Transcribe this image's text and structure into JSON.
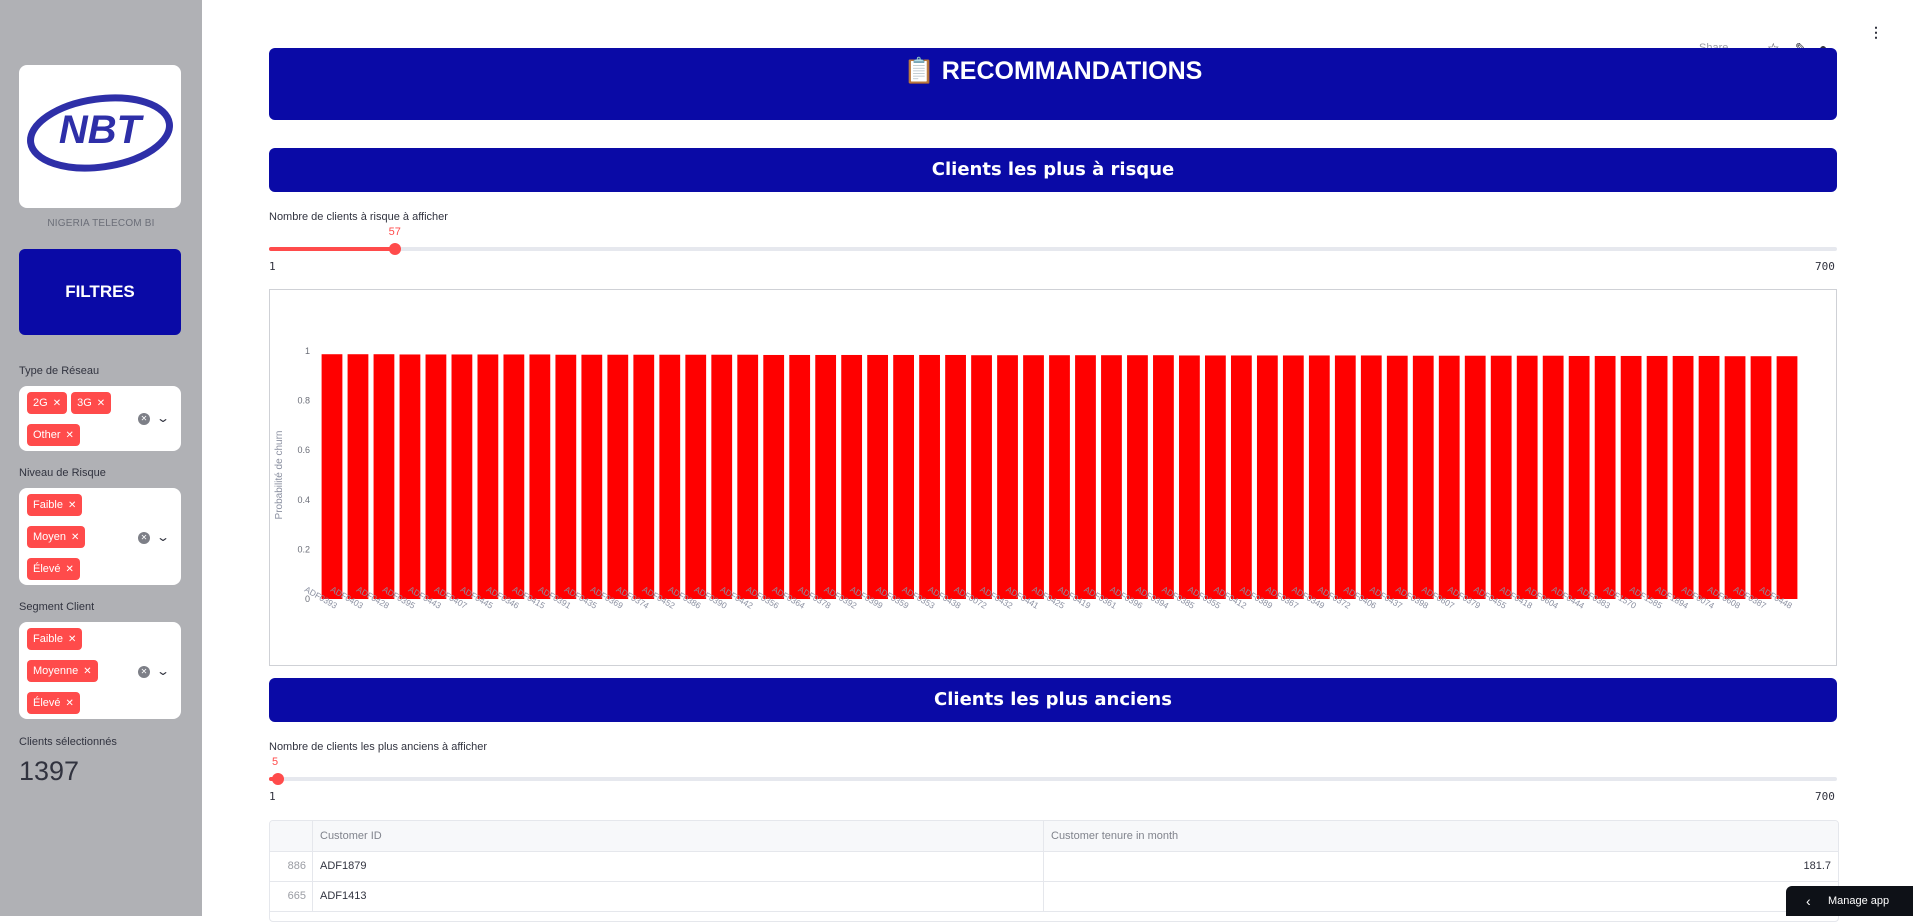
{
  "sidebar": {
    "logo_text": "NBT",
    "org_caption": "NIGERIA TELECOM BI",
    "filters_title": "FILTRES",
    "network": {
      "label": "Type de Réseau",
      "tags": [
        "2G",
        "3G",
        "Other"
      ]
    },
    "risk": {
      "label": "Niveau de Risque",
      "tags": [
        "Faible",
        "Moyen",
        "Élevé"
      ]
    },
    "segment": {
      "label": "Segment Client",
      "tags": [
        "Faible",
        "Moyenne",
        "Élevé"
      ]
    },
    "selected": {
      "label": "Clients sélectionnés",
      "value": "1397"
    }
  },
  "topbar": {
    "share": "Share",
    "icons": [
      "star-icon",
      "edit-icon",
      "github-icon",
      "more-icon"
    ]
  },
  "main": {
    "title_icon": "📋",
    "title": "RECOMMANDATIONS",
    "risk_section": {
      "heading": "Clients les plus à risque",
      "slider_label": "Nombre de clients à risque à afficher",
      "slider_value": "57",
      "slider_min": "1",
      "slider_max": "700",
      "slider_fraction": 0.0801
    },
    "tenure_section": {
      "heading": "Clients les plus anciens",
      "slider_label": "Nombre de clients les plus anciens à afficher",
      "slider_value": "5",
      "slider_min": "1",
      "slider_max": "700",
      "slider_fraction": 0.0057
    },
    "table": {
      "headers": [
        "",
        "Customer ID",
        "Customer tenure in month"
      ],
      "rows": [
        {
          "index": "886",
          "id": "ADF1879",
          "tenure": "181.7"
        },
        {
          "index": "665",
          "id": "ADF1413",
          "tenure": ""
        }
      ]
    }
  },
  "manage_app": "Manage app",
  "colors": {
    "brand": "#0a0aa6",
    "accent": "#ff4b4b",
    "bar": "#ff0000"
  },
  "chart_data": {
    "type": "bar",
    "title": "",
    "xlabel": "",
    "ylabel": "Probabilité de churn",
    "ylim": [
      0,
      1
    ],
    "yticks": [
      "0",
      "0.2",
      "0.4",
      "0.6",
      "0.8",
      "1"
    ],
    "grid": false,
    "categories": [
      "ADF0393",
      "ADF0403",
      "ADF0428",
      "ADF0395",
      "ADF0443",
      "ADF0407",
      "ADF0445",
      "ADF0346",
      "ADF0415",
      "ADF0391",
      "ADF0435",
      "ADF0369",
      "ADF0374",
      "ADF0452",
      "ADF0386",
      "ADF0390",
      "ADF0442",
      "ADF0356",
      "ADF0364",
      "ADF0378",
      "ADF0392",
      "ADF0399",
      "ADF0359",
      "ADF0353",
      "ADF0438",
      "ADF0072",
      "ADF0432",
      "ADF0441",
      "ADF0425",
      "ADF0419",
      "ADF0361",
      "ADF0396",
      "ADF0394",
      "ADF0385",
      "ADF0355",
      "ADF0412",
      "ADF0389",
      "ADF0367",
      "ADF0349",
      "ADF0372",
      "ADF0406",
      "ADF0437",
      "ADF0398",
      "ADF0607",
      "ADF0379",
      "ADF0455",
      "ADF0418",
      "ADF0604",
      "ADF0444",
      "ADF0383",
      "ADF1570",
      "ADF1585",
      "ADF1894",
      "ADF0074",
      "ADF0608",
      "ADF0387",
      "ADF0448"
    ],
    "values": [
      0.987,
      0.987,
      0.987,
      0.986,
      0.986,
      0.986,
      0.986,
      0.986,
      0.986,
      0.985,
      0.985,
      0.985,
      0.985,
      0.985,
      0.985,
      0.985,
      0.985,
      0.984,
      0.984,
      0.984,
      0.984,
      0.984,
      0.984,
      0.984,
      0.984,
      0.983,
      0.983,
      0.983,
      0.983,
      0.983,
      0.983,
      0.983,
      0.983,
      0.982,
      0.982,
      0.982,
      0.982,
      0.982,
      0.982,
      0.982,
      0.982,
      0.981,
      0.981,
      0.981,
      0.981,
      0.981,
      0.981,
      0.981,
      0.98,
      0.98,
      0.98,
      0.98,
      0.98,
      0.98,
      0.979,
      0.979,
      0.979
    ]
  }
}
